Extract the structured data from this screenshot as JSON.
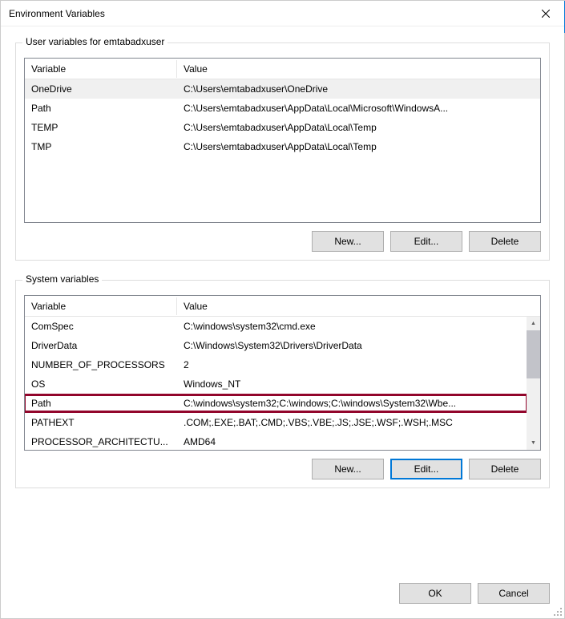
{
  "window": {
    "title": "Environment Variables"
  },
  "userVars": {
    "legend": "User variables for emtabadxuser",
    "headers": {
      "variable": "Variable",
      "value": "Value"
    },
    "rows": [
      {
        "variable": "OneDrive",
        "value": "C:\\Users\\emtabadxuser\\OneDrive",
        "selected": true
      },
      {
        "variable": "Path",
        "value": "C:\\Users\\emtabadxuser\\AppData\\Local\\Microsoft\\WindowsA..."
      },
      {
        "variable": "TEMP",
        "value": "C:\\Users\\emtabadxuser\\AppData\\Local\\Temp"
      },
      {
        "variable": "TMP",
        "value": "C:\\Users\\emtabadxuser\\AppData\\Local\\Temp"
      }
    ],
    "buttons": {
      "new": "New...",
      "edit": "Edit...",
      "delete": "Delete"
    }
  },
  "systemVars": {
    "legend": "System variables",
    "headers": {
      "variable": "Variable",
      "value": "Value"
    },
    "rows": [
      {
        "variable": "ComSpec",
        "value": "C:\\windows\\system32\\cmd.exe"
      },
      {
        "variable": "DriverData",
        "value": "C:\\Windows\\System32\\Drivers\\DriverData"
      },
      {
        "variable": "NUMBER_OF_PROCESSORS",
        "value": "2"
      },
      {
        "variable": "OS",
        "value": "Windows_NT"
      },
      {
        "variable": "Path",
        "value": "C:\\windows\\system32;C:\\windows;C:\\windows\\System32\\Wbe...",
        "highlighted": true
      },
      {
        "variable": "PATHEXT",
        "value": ".COM;.EXE;.BAT;.CMD;.VBS;.VBE;.JS;.JSE;.WSF;.WSH;.MSC"
      },
      {
        "variable": "PROCESSOR_ARCHITECTU...",
        "value": "AMD64"
      }
    ],
    "buttons": {
      "new": "New...",
      "edit": "Edit...",
      "delete": "Delete"
    }
  },
  "footer": {
    "ok": "OK",
    "cancel": "Cancel"
  }
}
